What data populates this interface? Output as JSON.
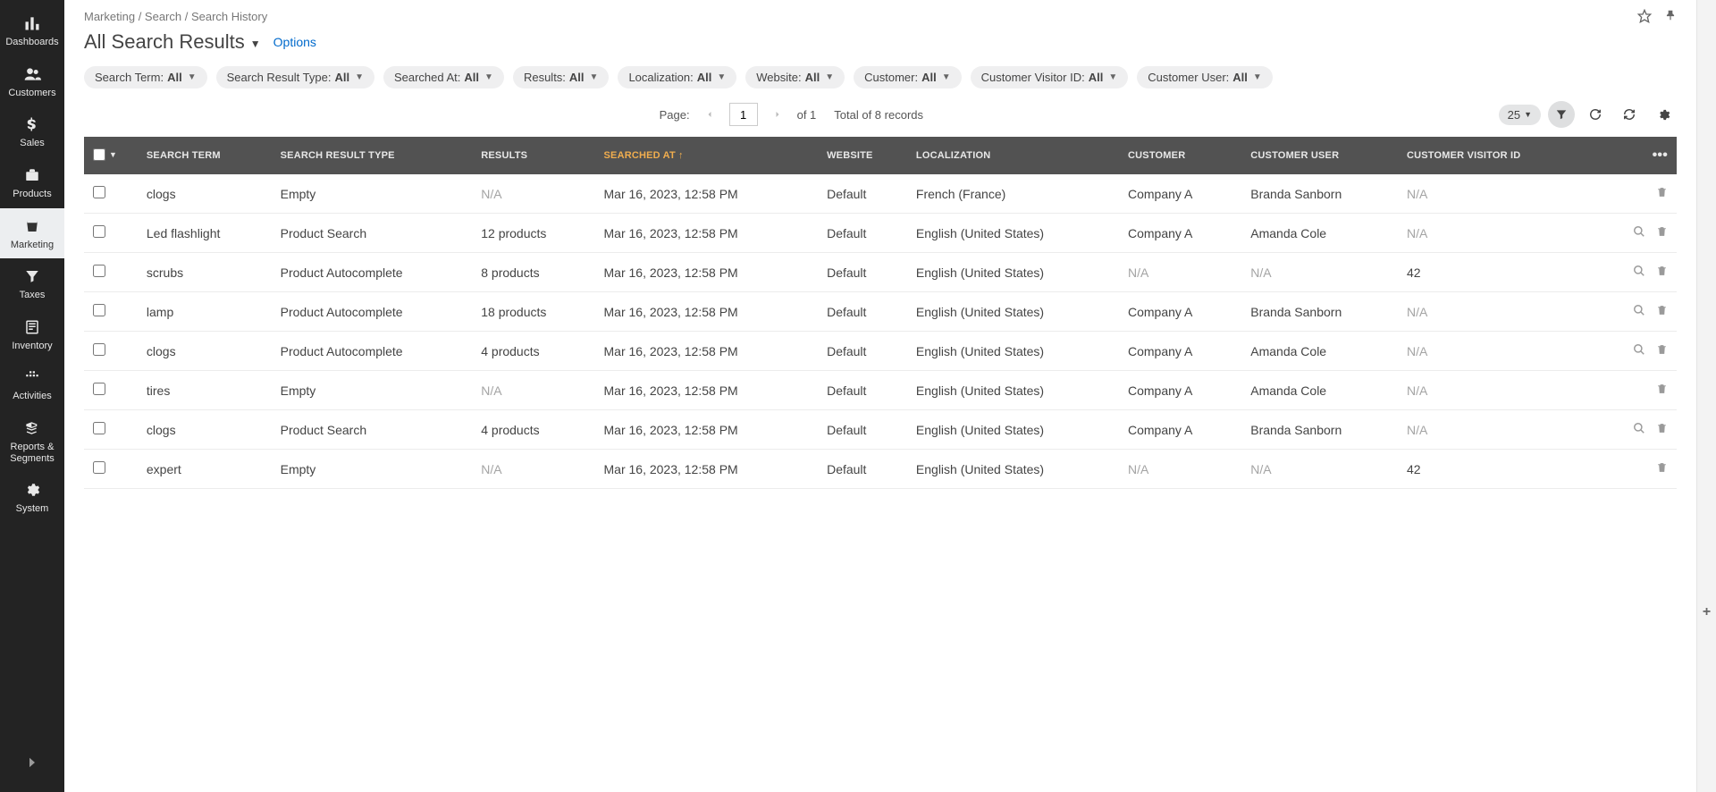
{
  "sidebar": {
    "items": [
      {
        "id": "dashboards",
        "label": "Dashboards"
      },
      {
        "id": "customers",
        "label": "Customers"
      },
      {
        "id": "sales",
        "label": "Sales"
      },
      {
        "id": "products",
        "label": "Products"
      },
      {
        "id": "marketing",
        "label": "Marketing"
      },
      {
        "id": "taxes",
        "label": "Taxes"
      },
      {
        "id": "inventory",
        "label": "Inventory"
      },
      {
        "id": "activities",
        "label": "Activities"
      },
      {
        "id": "reports",
        "label": "Reports & Segments"
      },
      {
        "id": "system",
        "label": "System"
      }
    ],
    "active_id": "marketing"
  },
  "breadcrumb": {
    "parts": [
      "Marketing",
      "Search",
      "Search History"
    ]
  },
  "title": "All Search Results",
  "options_label": "Options",
  "filters": [
    {
      "label": "Search Term",
      "value": "All"
    },
    {
      "label": "Search Result Type",
      "value": "All"
    },
    {
      "label": "Searched At",
      "value": "All"
    },
    {
      "label": "Results",
      "value": "All"
    },
    {
      "label": "Localization",
      "value": "All"
    },
    {
      "label": "Website",
      "value": "All"
    },
    {
      "label": "Customer",
      "value": "All"
    },
    {
      "label": "Customer Visitor ID",
      "value": "All"
    },
    {
      "label": "Customer User",
      "value": "All"
    }
  ],
  "pagination": {
    "page_label": "Page:",
    "page": "1",
    "of_label": "of 1",
    "total_label": "Total of 8 records",
    "pagesize": "25"
  },
  "columns": [
    {
      "key": "term",
      "label": "Search Term"
    },
    {
      "key": "type",
      "label": "Search Result Type"
    },
    {
      "key": "results",
      "label": "Results"
    },
    {
      "key": "searched_at",
      "label": "Searched At",
      "sorted": true,
      "dir": "asc"
    },
    {
      "key": "website",
      "label": "Website"
    },
    {
      "key": "localization",
      "label": "Localization"
    },
    {
      "key": "customer",
      "label": "Customer"
    },
    {
      "key": "customer_user",
      "label": "Customer User"
    },
    {
      "key": "visitor_id",
      "label": "Customer Visitor ID"
    }
  ],
  "rows": [
    {
      "term": "clogs",
      "type": "Empty",
      "results": "N/A",
      "searched_at": "Mar 16, 2023, 12:58 PM",
      "website": "Default",
      "localization": "French (France)",
      "customer": "Company A",
      "customer_user": "Branda Sanborn",
      "visitor_id": "N/A",
      "has_search": false
    },
    {
      "term": "Led flashlight",
      "type": "Product Search",
      "results": "12 products",
      "searched_at": "Mar 16, 2023, 12:58 PM",
      "website": "Default",
      "localization": "English (United States)",
      "customer": "Company A",
      "customer_user": "Amanda Cole",
      "visitor_id": "N/A",
      "has_search": true
    },
    {
      "term": "scrubs",
      "type": "Product Autocomplete",
      "results": "8 products",
      "searched_at": "Mar 16, 2023, 12:58 PM",
      "website": "Default",
      "localization": "English (United States)",
      "customer": "N/A",
      "customer_user": "N/A",
      "visitor_id": "42",
      "has_search": true
    },
    {
      "term": "lamp",
      "type": "Product Autocomplete",
      "results": "18 products",
      "searched_at": "Mar 16, 2023, 12:58 PM",
      "website": "Default",
      "localization": "English (United States)",
      "customer": "Company A",
      "customer_user": "Branda Sanborn",
      "visitor_id": "N/A",
      "has_search": true
    },
    {
      "term": "clogs",
      "type": "Product Autocomplete",
      "results": "4 products",
      "searched_at": "Mar 16, 2023, 12:58 PM",
      "website": "Default",
      "localization": "English (United States)",
      "customer": "Company A",
      "customer_user": "Amanda Cole",
      "visitor_id": "N/A",
      "has_search": true
    },
    {
      "term": "tires",
      "type": "Empty",
      "results": "N/A",
      "searched_at": "Mar 16, 2023, 12:58 PM",
      "website": "Default",
      "localization": "English (United States)",
      "customer": "Company A",
      "customer_user": "Amanda Cole",
      "visitor_id": "N/A",
      "has_search": false
    },
    {
      "term": "clogs",
      "type": "Product Search",
      "results": "4 products",
      "searched_at": "Mar 16, 2023, 12:58 PM",
      "website": "Default",
      "localization": "English (United States)",
      "customer": "Company A",
      "customer_user": "Branda Sanborn",
      "visitor_id": "N/A",
      "has_search": true
    },
    {
      "term": "expert",
      "type": "Empty",
      "results": "N/A",
      "searched_at": "Mar 16, 2023, 12:58 PM",
      "website": "Default",
      "localization": "English (United States)",
      "customer": "N/A",
      "customer_user": "N/A",
      "visitor_id": "42",
      "has_search": false
    }
  ]
}
